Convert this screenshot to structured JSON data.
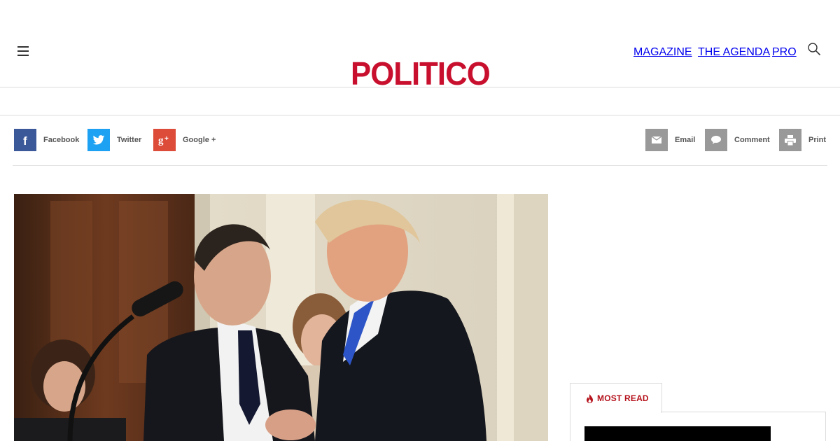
{
  "header": {
    "logo_text": "POLITICO",
    "brand_color": "#c8102e",
    "nav": [
      {
        "label": "MAGAZINE"
      },
      {
        "label": "THE AGENDA"
      },
      {
        "label": "PRO"
      }
    ],
    "menu_icon": "hamburger-menu-icon",
    "search_icon": "search-icon"
  },
  "share": {
    "left": [
      {
        "label": "Facebook",
        "icon": "facebook-icon",
        "color": "#3b5998"
      },
      {
        "label": "Twitter",
        "icon": "twitter-icon",
        "color": "#1da1f2"
      },
      {
        "label": "Google +",
        "icon": "google-plus-icon",
        "color": "#dd4b39"
      }
    ],
    "right": [
      {
        "label": "Email",
        "icon": "email-icon",
        "color": "#999999"
      },
      {
        "label": "Comment",
        "icon": "comment-icon",
        "color": "#999999"
      },
      {
        "label": "Print",
        "icon": "print-icon",
        "color": "#999999"
      }
    ]
  },
  "sidebar": {
    "most_read_label": "MOST READ",
    "accent_color": "#b5121b"
  }
}
